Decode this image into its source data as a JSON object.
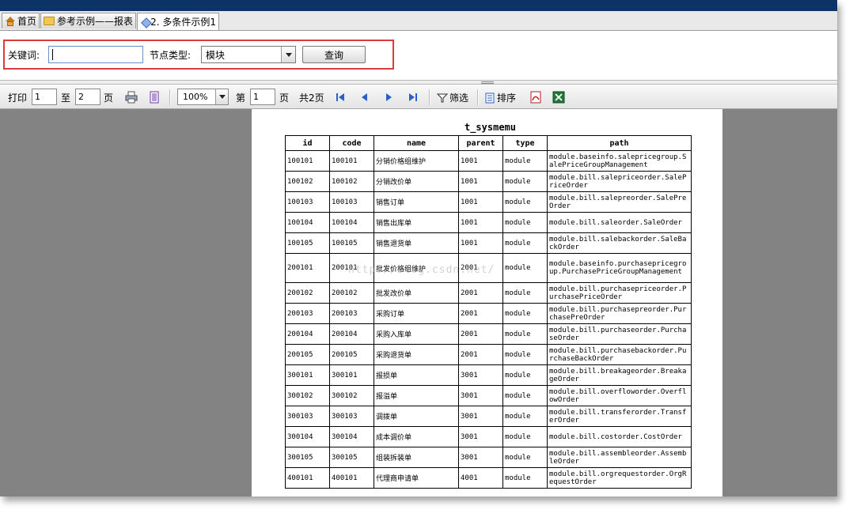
{
  "tabs": [
    {
      "label": "首页",
      "icon": "home-icon"
    },
    {
      "label": "参考示例——报表",
      "icon": "folder-icon"
    },
    {
      "label": "2. 多条件示例1",
      "icon": "report-icon"
    }
  ],
  "search": {
    "keyword_label": "关键词:",
    "keyword_value": "",
    "node_type_label": "节点类型:",
    "node_type_selected": "模块",
    "query_button": "查询"
  },
  "toolbar": {
    "print_label": "打印",
    "from_page": "1",
    "to_label": "至",
    "to_page": "2",
    "page_label": "页",
    "zoom": "100%",
    "nav_prefix": "第",
    "current_page": "1",
    "nav_suffix": "页",
    "total_pages": "共2页",
    "filter_label": "筛选",
    "sort_label": "排序"
  },
  "report": {
    "title": "t_sysmemu",
    "columns": [
      "id",
      "code",
      "name",
      "parent",
      "type",
      "path"
    ],
    "rows": [
      [
        "100101",
        "100101",
        "分销价格组维护",
        "1001",
        "module",
        "module.baseinfo.salepricegroup.SalePriceGroupManagement"
      ],
      [
        "100102",
        "100102",
        "分销改价单",
        "1001",
        "module",
        "module.bill.salepriceorder.SalePriceOrder"
      ],
      [
        "100103",
        "100103",
        "销售订单",
        "1001",
        "module",
        "module.bill.salepreorder.SalePreOrder"
      ],
      [
        "100104",
        "100104",
        "销售出库单",
        "1001",
        "module",
        "module.bill.saleorder.SaleOrder"
      ],
      [
        "100105",
        "100105",
        "销售退货单",
        "1001",
        "module",
        "module.bill.salebackorder.SaleBackOrder"
      ],
      [
        "200101",
        "200101",
        "批发价格组维护",
        "2001",
        "module",
        "module.baseinfo.purchasepricegroup.PurchasePriceGroupManagement"
      ],
      [
        "200102",
        "200102",
        "批发改价单",
        "2001",
        "module",
        "module.bill.purchasepriceorder.PurchasePriceOrder"
      ],
      [
        "200103",
        "200103",
        "采购订单",
        "2001",
        "module",
        "module.bill.purchasepreorder.PurchasePreOrder"
      ],
      [
        "200104",
        "200104",
        "采购入库单",
        "2001",
        "module",
        "module.bill.purchaseorder.PurchaseOrder"
      ],
      [
        "200105",
        "200105",
        "采购退货单",
        "2001",
        "module",
        "module.bill.purchasebackorder.PurchaseBackOrder"
      ],
      [
        "300101",
        "300101",
        "报损单",
        "3001",
        "module",
        "module.bill.breakageorder.BreakageOrder"
      ],
      [
        "300102",
        "300102",
        "报溢单",
        "3001",
        "module",
        "module.bill.overfloworder.OverflowOrder"
      ],
      [
        "300103",
        "300103",
        "调拨单",
        "3001",
        "module",
        "module.bill.transferorder.TransferOrder"
      ],
      [
        "300104",
        "300104",
        "成本调价单",
        "3001",
        "module",
        "module.bill.costorder.CostOrder"
      ],
      [
        "300105",
        "300105",
        "组装拆装单",
        "3001",
        "module",
        "module.bill.assembleorder.AssembleOrder"
      ],
      [
        "400101",
        "400101",
        "代理商申请单",
        "4001",
        "module",
        "module.bill.orgrequestorder.OrgRequestOrder"
      ]
    ]
  },
  "watermark": "http://blog.csdn.net/",
  "colors": {
    "title_bar": "#0c3366",
    "highlight_box": "#d93b3b",
    "report_bg": "#838383"
  }
}
